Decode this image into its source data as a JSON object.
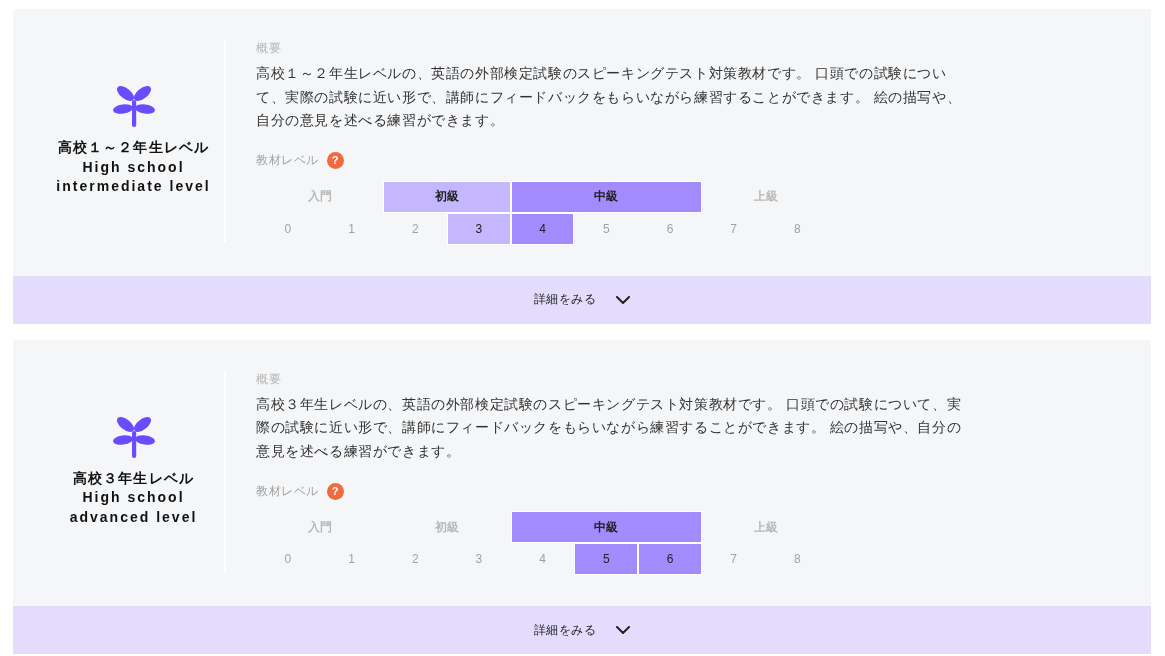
{
  "courses": [
    {
      "title_lines": [
        "高校１～２年生レベル",
        "High school",
        "intermediate level"
      ],
      "summary_label": "概要",
      "summary": "高校１～２年生レベルの、英語の外部検定試験のスピーキングテスト対策教材です。 口頭での試験について、実際の試験に近い形で、講師にフィードバックをもらいながら練習することができます。 絵の描写や、自分の意見を述べる練習ができます。",
      "level_label": "教材レベル",
      "help_mark": "?",
      "bands": [
        {
          "label": "入門",
          "selected": false,
          "levels": [
            {
              "label": "0",
              "selected": false
            },
            {
              "label": "1",
              "selected": false
            }
          ]
        },
        {
          "label": "初級",
          "selected": true,
          "color": "#c4b7fd",
          "levels": [
            {
              "label": "2",
              "selected": false
            },
            {
              "label": "3",
              "selected": true
            }
          ]
        },
        {
          "label": "中級",
          "selected": true,
          "color": "#a18bfd",
          "levels": [
            {
              "label": "4",
              "selected": true
            },
            {
              "label": "5",
              "selected": false
            },
            {
              "label": "6",
              "selected": false
            }
          ]
        },
        {
          "label": "上級",
          "selected": false,
          "levels": [
            {
              "label": "7",
              "selected": false
            },
            {
              "label": "8",
              "selected": false
            }
          ]
        }
      ],
      "details_button": {
        "label": "詳細をみる",
        "expanded": false
      }
    },
    {
      "title_lines": [
        "高校３年生レベル",
        "High school",
        "advanced level"
      ],
      "summary_label": "概要",
      "summary": "高校３年生レベルの、英語の外部検定試験のスピーキングテスト対策教材です。 口頭での試験について、実際の試験に近い形で、講師にフィードバックをもらいながら練習することができます。 絵の描写や、自分の意見を述べる練習ができます。",
      "level_label": "教材レベル",
      "help_mark": "?",
      "bands": [
        {
          "label": "入門",
          "selected": false,
          "levels": [
            {
              "label": "0",
              "selected": false
            },
            {
              "label": "1",
              "selected": false
            }
          ]
        },
        {
          "label": "初級",
          "selected": false,
          "levels": [
            {
              "label": "2",
              "selected": false
            },
            {
              "label": "3",
              "selected": false
            }
          ]
        },
        {
          "label": "中級",
          "selected": true,
          "color": "#a18bfd",
          "levels": [
            {
              "label": "4",
              "selected": false
            },
            {
              "label": "5",
              "selected": true
            },
            {
              "label": "6",
              "selected": true
            }
          ]
        },
        {
          "label": "上級",
          "selected": false,
          "levels": [
            {
              "label": "7",
              "selected": false
            },
            {
              "label": "8",
              "selected": false
            }
          ]
        }
      ],
      "details_button": {
        "label": "詳細をみる",
        "expanded": false
      }
    }
  ]
}
